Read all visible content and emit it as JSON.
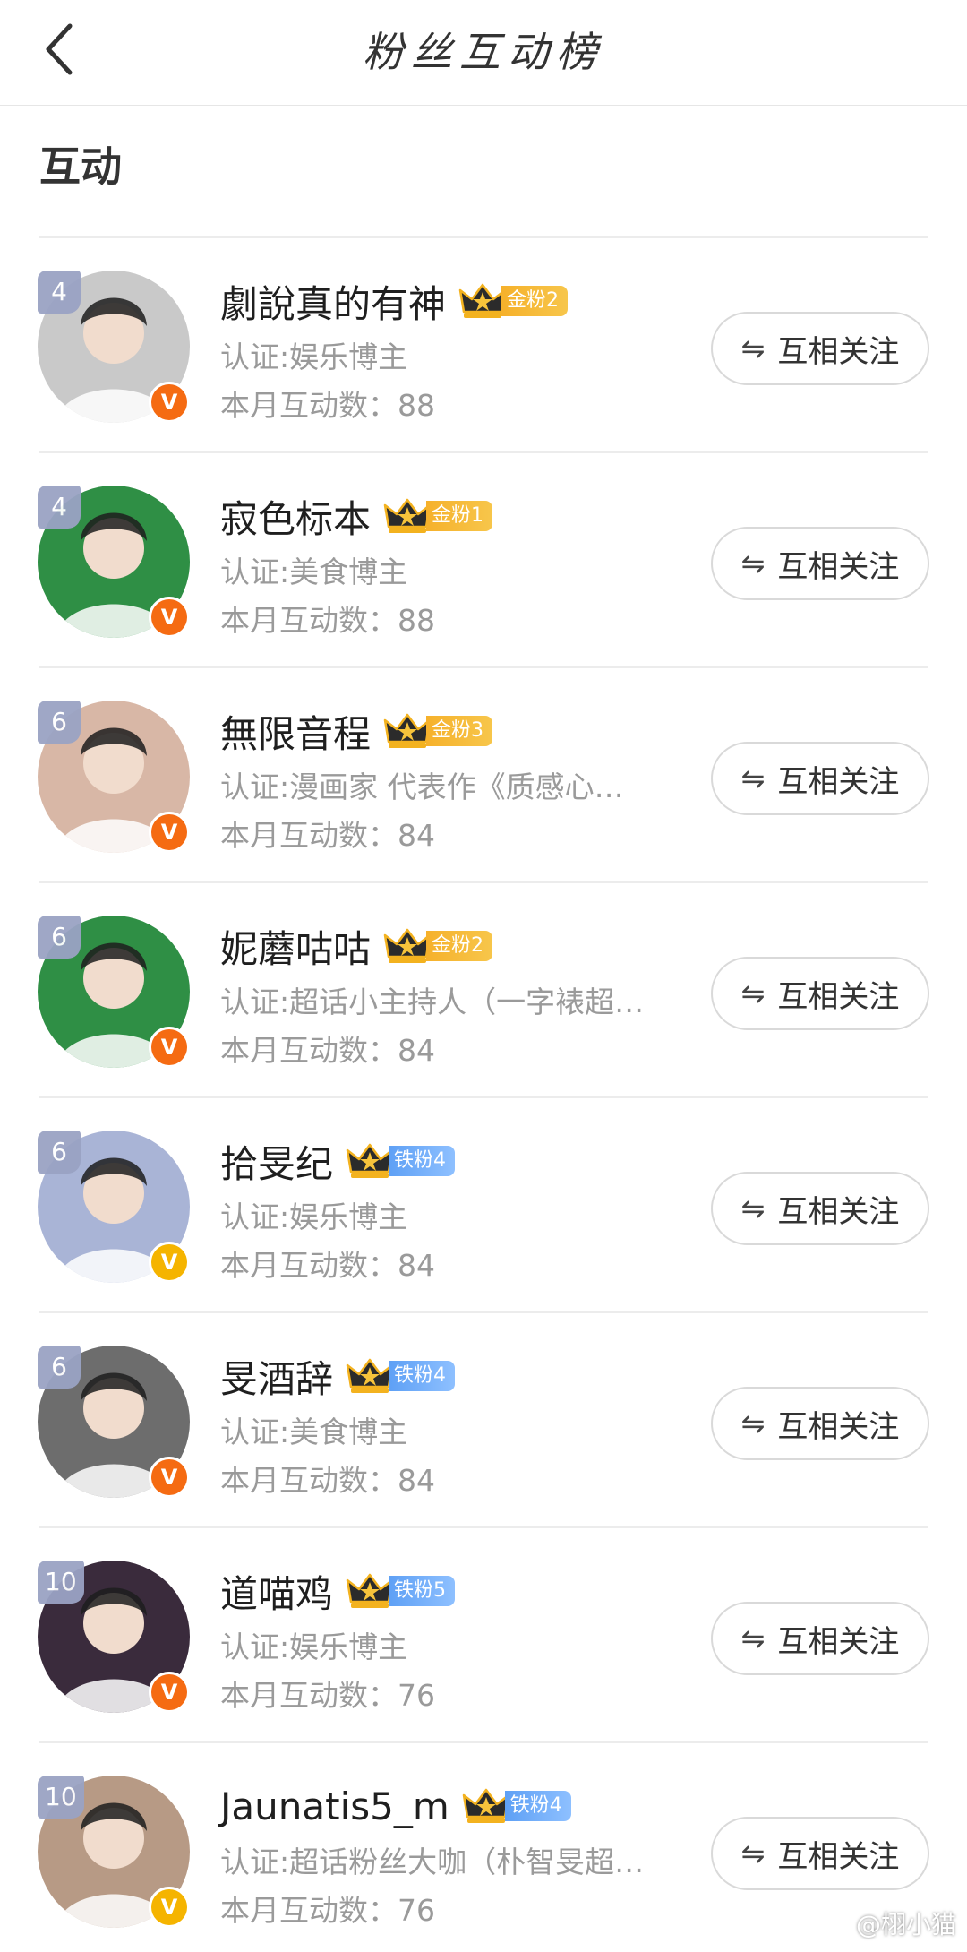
{
  "header": {
    "title": "粉丝互动榜",
    "back_icon": "chevron-left-icon"
  },
  "section": {
    "title": "互动"
  },
  "follow_label": "互相关注",
  "follow_icon": "⇋",
  "rows": [
    {
      "rank": "4",
      "name": "劇說真的有神",
      "badge_type": "gold",
      "badge_label": "金粉2",
      "cert": "认证:娱乐博主",
      "count": "本月互动数：88",
      "verify": "orange",
      "avatar_color": "#c9c9c9"
    },
    {
      "rank": "4",
      "name": "寂色标本",
      "badge_type": "gold",
      "badge_label": "金粉1",
      "cert": "认证:美食博主",
      "count": "本月互动数：88",
      "verify": "orange",
      "avatar_color": "#2f8f45"
    },
    {
      "rank": "6",
      "name": "無限音程",
      "badge_type": "gold",
      "badge_label": "金粉3",
      "cert": "认证:漫画家 代表作《质感心…",
      "count": "本月互动数：84",
      "verify": "orange",
      "avatar_color": "#d8b7a6"
    },
    {
      "rank": "6",
      "name": "妮蘑咕咕",
      "badge_type": "gold",
      "badge_label": "金粉2",
      "cert": "认证:超话小主持人（一字裱超…",
      "count": "本月互动数：84",
      "verify": "orange",
      "avatar_color": "#2f8f45"
    },
    {
      "rank": "6",
      "name": "拾旻纪",
      "badge_type": "iron",
      "badge_label": "铁粉4",
      "cert": "认证:娱乐博主",
      "count": "本月互动数：84",
      "verify": "yellow",
      "avatar_color": "#a9b4d6"
    },
    {
      "rank": "6",
      "name": "旻酒辞",
      "badge_type": "iron",
      "badge_label": "铁粉4",
      "cert": "认证:美食博主",
      "count": "本月互动数：84",
      "verify": "orange",
      "avatar_color": "#6d6d6d"
    },
    {
      "rank": "10",
      "name": "道喵鸡",
      "badge_type": "iron",
      "badge_label": "铁粉5",
      "cert": "认证:娱乐博主",
      "count": "本月互动数：76",
      "verify": "orange",
      "avatar_color": "#3a2b3c"
    },
    {
      "rank": "10",
      "name": "Jaunatis5_m",
      "badge_type": "iron",
      "badge_label": "铁粉4",
      "cert": "认证:超话粉丝大咖（朴智旻超…",
      "count": "本月互动数：76",
      "verify": "yellow",
      "avatar_color": "#b79a85"
    }
  ],
  "watermark": {
    "text": "@栩小猫",
    "icon": "weibo-icon"
  },
  "colors": {
    "gold_badge": "#f6b12b",
    "iron_badge": "#5ea0f5",
    "rank_badge": "#9aa3c4",
    "v_orange": "#f56b12",
    "v_yellow": "#f5b400"
  }
}
